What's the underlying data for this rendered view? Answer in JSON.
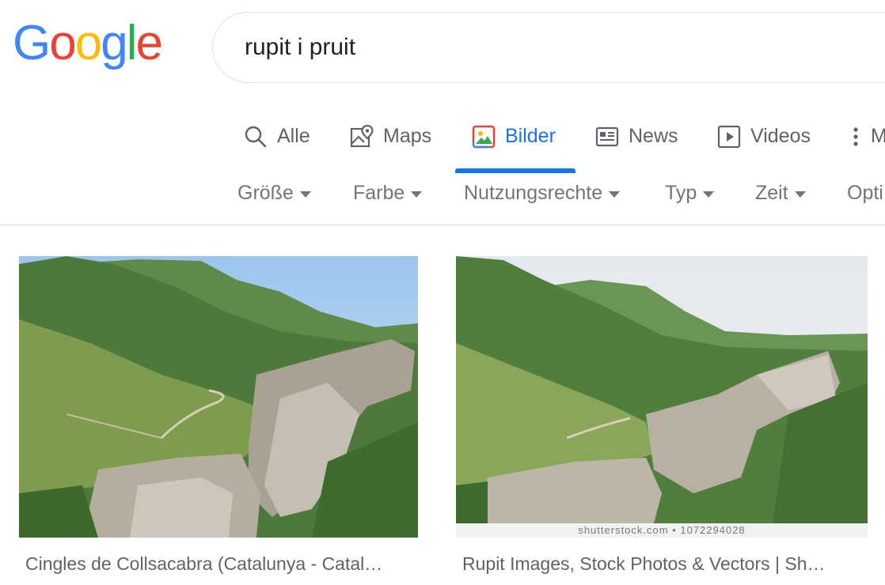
{
  "logo": {
    "text": "Google",
    "letters": [
      {
        "char": "G",
        "color": "#4285F4"
      },
      {
        "char": "o",
        "color": "#EA4335"
      },
      {
        "char": "o",
        "color": "#FBBC05"
      },
      {
        "char": "g",
        "color": "#4285F4"
      },
      {
        "char": "l",
        "color": "#34A853"
      },
      {
        "char": "e",
        "color": "#EA4335"
      }
    ]
  },
  "search": {
    "query": "rupit i pruit"
  },
  "tabs": [
    {
      "label": "Alle",
      "icon": "search-icon",
      "active": false
    },
    {
      "label": "Maps",
      "icon": "map-pin-icon",
      "active": false
    },
    {
      "label": "Bilder",
      "icon": "image-icon",
      "active": true
    },
    {
      "label": "News",
      "icon": "newspaper-icon",
      "active": false
    },
    {
      "label": "Videos",
      "icon": "play-icon",
      "active": false
    },
    {
      "label": "M",
      "icon": "more-vert-icon",
      "active": false
    }
  ],
  "filters": [
    {
      "label": "Größe"
    },
    {
      "label": "Farbe"
    },
    {
      "label": "Nutzungsrechte"
    },
    {
      "label": "Typ"
    },
    {
      "label": "Zeit"
    },
    {
      "label": "Opti"
    }
  ],
  "results": [
    {
      "caption": "Cingles de Collsacabra (Catalunya - Catal…"
    },
    {
      "caption": "Rupit Images, Stock Photos & Vectors | Sh…",
      "watermark": "shutterstock.com • 1072294028"
    }
  ],
  "colors": {
    "accent": "#1a73e8",
    "text_muted": "#5f6368"
  }
}
